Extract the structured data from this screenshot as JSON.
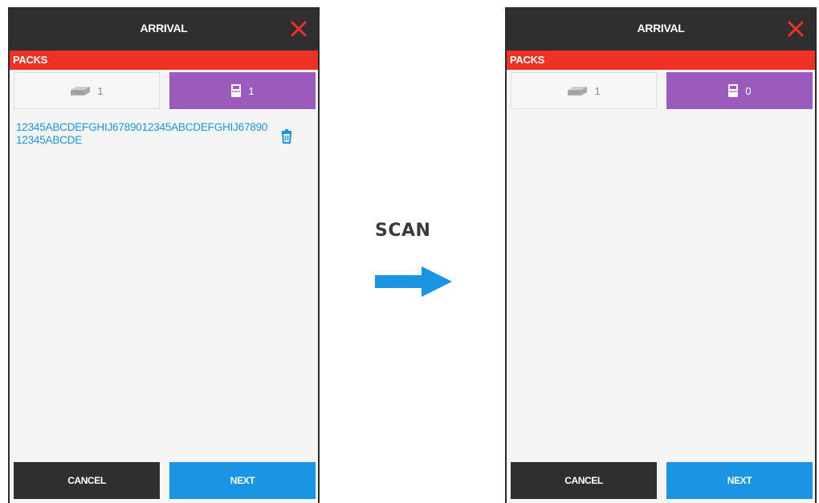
{
  "annotation": {
    "scan_label": "SCAN"
  },
  "colors": {
    "header_bg": "#2f2f2f",
    "section_bar": "#ef3225",
    "tab_active": "#9b5bbd",
    "accent_blue": "#1a95e4",
    "close_red": "#ef3225"
  },
  "screens": [
    {
      "header": {
        "title": "ARRIVAL",
        "close_icon": "close-icon"
      },
      "section": {
        "label": "PACKS"
      },
      "tabs": [
        {
          "icon": "scanner-icon",
          "count": "1"
        },
        {
          "icon": "package-icon",
          "count": "1"
        }
      ],
      "items": [
        {
          "code": "12345ABCDEFGHIJ6789012345ABCDEFGHIJ6789012345ABCDE",
          "delete_icon": "trash-icon"
        }
      ],
      "footer": {
        "cancel_label": "CANCEL",
        "next_label": "NEXT"
      }
    },
    {
      "header": {
        "title": "ARRIVAL",
        "close_icon": "close-icon"
      },
      "section": {
        "label": "PACKS"
      },
      "tabs": [
        {
          "icon": "scanner-icon",
          "count": "1"
        },
        {
          "icon": "package-icon",
          "count": "0"
        }
      ],
      "items": [],
      "footer": {
        "cancel_label": "CANCEL",
        "next_label": "NEXT"
      }
    }
  ]
}
